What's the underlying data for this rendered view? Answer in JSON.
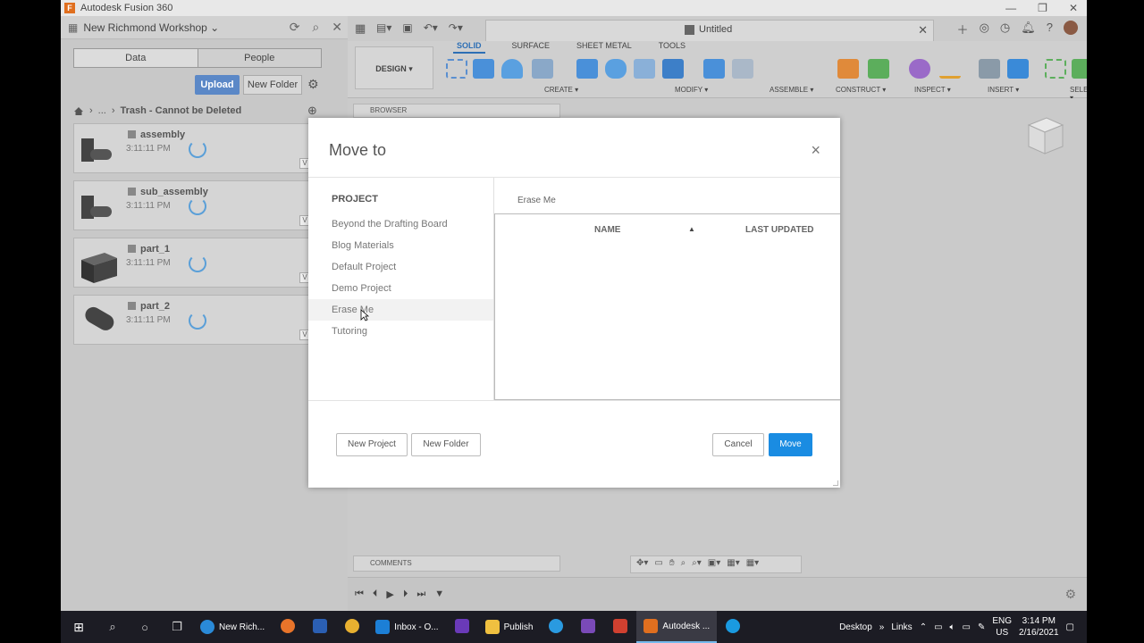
{
  "window": {
    "title": "Autodesk Fusion 360",
    "controls": [
      "—",
      "❐",
      "✕"
    ]
  },
  "data_panel": {
    "project_name": "New Richmond Workshop",
    "tabs": [
      "Data",
      "People"
    ],
    "upload_label": "Upload",
    "new_folder_label": "New Folder",
    "breadcrumb_ellipsis": "...",
    "breadcrumb_current": "Trash - Cannot be Deleted",
    "files": [
      {
        "name": "assembly",
        "time": "3:11:11 PM",
        "version": "V"
      },
      {
        "name": "sub_assembly",
        "time": "3:11:11 PM",
        "version": "V"
      },
      {
        "name": "part_1",
        "time": "3:11:11 PM",
        "version": "V"
      },
      {
        "name": "part_2",
        "time": "3:11:11 PM",
        "version": "V"
      }
    ]
  },
  "doc": {
    "tab_name": "Untitled"
  },
  "ribbon": {
    "workspace": "DESIGN ▾",
    "tabs": [
      "SOLID",
      "SURFACE",
      "SHEET METAL",
      "TOOLS"
    ],
    "groups": [
      "CREATE ▾",
      "MODIFY ▾",
      "ASSEMBLE ▾",
      "CONSTRUCT ▾",
      "INSPECT ▾",
      "INSERT ▾",
      "SELECT ▾"
    ]
  },
  "viewport": {
    "browser_label": "BROWSER",
    "comments_label": "COMMENTS"
  },
  "modal": {
    "title": "Move to",
    "close": "×",
    "project_heading": "PROJECT",
    "projects": [
      "Beyond the Drafting Board",
      "Blog Materials",
      "Default Project",
      "Demo Project",
      "Erase Me",
      "Tutoring"
    ],
    "selected_project": "Erase Me",
    "col_name": "NAME",
    "sort_indicator": "▲",
    "col_updated": "LAST UPDATED",
    "new_project_label": "New Project",
    "new_folder_label": "New Folder",
    "cancel_label": "Cancel",
    "move_label": "Move"
  },
  "taskbar": {
    "apps": [
      "New Rich...",
      "Inbox - O...",
      "Publish",
      "Autodesk ..."
    ],
    "desktop": "Desktop",
    "links": "Links",
    "lang": [
      "ENG",
      "US"
    ],
    "time": "3:14 PM",
    "date": "2/16/2021"
  },
  "colors": {
    "accent": "#1a8ce2",
    "upload": "#5b88c7",
    "fusion_orange": "#e06f1f"
  }
}
